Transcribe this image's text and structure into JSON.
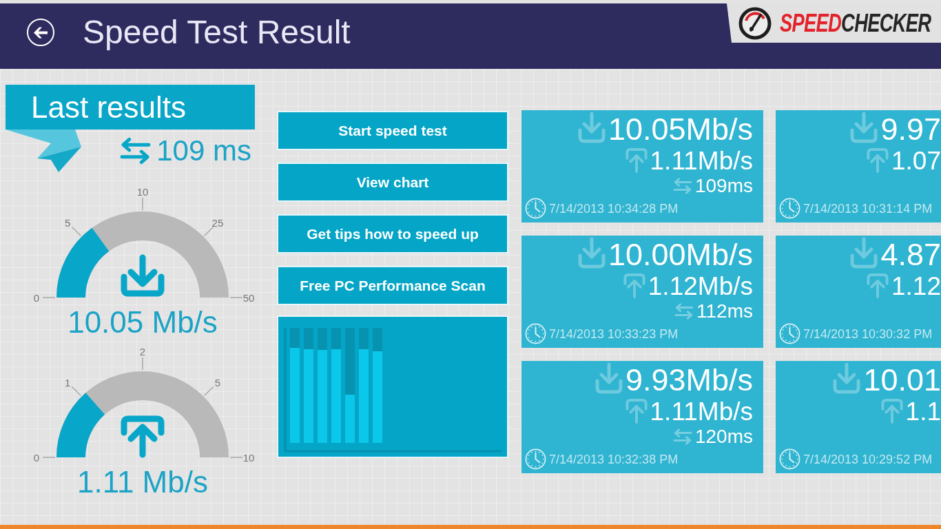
{
  "header": {
    "title": "Speed Test Result",
    "logo": {
      "accent": "SPEED",
      "rest": "CHECKER"
    }
  },
  "last_results": {
    "heading": "Last results",
    "ping": "109 ms",
    "gauges": [
      {
        "kind": "download",
        "ticks": [
          "0",
          "5",
          "10",
          "25",
          "50"
        ],
        "level": 0.3,
        "reading": "10.05 Mb/s"
      },
      {
        "kind": "upload",
        "ticks": [
          "0",
          "1",
          "2",
          "5",
          "10"
        ],
        "level": 0.27,
        "reading": "1.11 Mb/s"
      }
    ]
  },
  "actions": [
    "Start speed test",
    "View chart",
    "Get tips how to speed up",
    "Free PC Performance Scan"
  ],
  "results": [
    {
      "download": "10.05Mb/s",
      "upload": "1.11Mb/s",
      "ping": "109ms",
      "time": "7/14/2013 10:34:28 PM"
    },
    {
      "download": "10.00Mb/s",
      "upload": "1.12Mb/s",
      "ping": "112ms",
      "time": "7/14/2013 10:33:23 PM"
    },
    {
      "download": "9.93Mb/s",
      "upload": "1.11Mb/s",
      "ping": "120ms",
      "time": "7/14/2013 10:32:38 PM"
    },
    {
      "download": "9.97",
      "upload": "1.07",
      "time": "7/14/2013 10:31:14 PM"
    },
    {
      "download": "4.87",
      "upload": "1.12",
      "time": "7/14/2013 10:30:32 PM"
    },
    {
      "download": "10.01",
      "upload": "1.1",
      "time": "7/14/2013 10:29:52 PM"
    }
  ]
}
